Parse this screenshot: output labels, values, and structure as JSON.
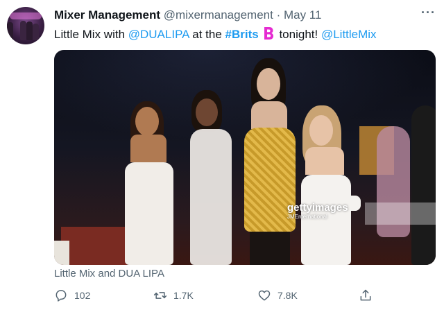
{
  "tweet": {
    "author_name": "Mixer Management",
    "author_handle": "@mixermanagement",
    "separator": "·",
    "date": "May 11",
    "text_parts": {
      "t1": "Little Mix with ",
      "mention1": "@DUALIPA",
      "t2": " at the ",
      "hashtag": "#Brits",
      "t3": " tonight! ",
      "mention2": "@LittleMix"
    },
    "media": {
      "watermark_brand": "gettyimages",
      "watermark_credit": "JMEnternational"
    },
    "caption": "Little Mix and DUA LIPA",
    "actions": {
      "reply_count": "102",
      "retweet_count": "1.7K",
      "like_count": "7.8K"
    },
    "more_label": "···"
  },
  "colors": {
    "link": "#1d9bf0",
    "secondary_text": "#536471",
    "brits_icon": "#e52bd1"
  },
  "icons": [
    "avatar-image",
    "brits-hashflag-icon",
    "more-icon",
    "reply-icon",
    "retweet-icon",
    "like-icon",
    "share-icon"
  ]
}
